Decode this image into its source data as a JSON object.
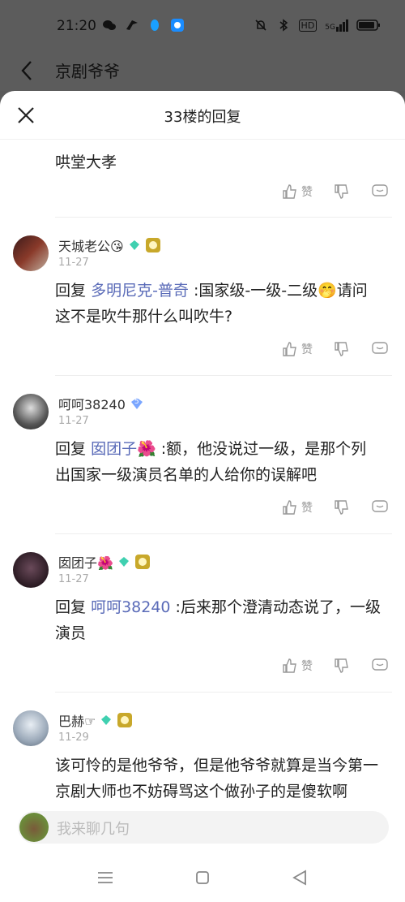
{
  "status": {
    "time": "21:20",
    "left_icons": [
      "wechat-icon",
      "bird-icon",
      "qq-icon",
      "app-icon"
    ],
    "right_icons": [
      "mute-bell-icon",
      "bluetooth-icon",
      "hd-icon",
      "signal-5g-icon",
      "battery-icon"
    ],
    "hd_label": "HD",
    "net_label": "5G"
  },
  "background_page": {
    "title": "京剧爷爷"
  },
  "sheet": {
    "title": "33楼的回复"
  },
  "first_item": {
    "content": "哄堂大孝"
  },
  "actions": {
    "like_label": "赞"
  },
  "replies": [
    {
      "name": "天城老公😘",
      "date": "11-27",
      "prefix": "回复",
      "mention": "多明尼克-普奇",
      "text": " :国家级-一级-二级🤭请问这不是吹牛那什么叫吹牛?"
    },
    {
      "name": "呵呵38240",
      "date": "11-27",
      "prefix": "回复",
      "mention": "囡团子🌺",
      "text": " :额，他没说过一级，是那个列出国家一级演员名单的人给你的误解吧"
    },
    {
      "name": "囡团子🌺",
      "date": "11-27",
      "prefix": "回复",
      "mention": "呵呵38240",
      "text": " :后来那个澄清动态说了，一级演员"
    },
    {
      "name": "巴赫☞",
      "date": "11-29",
      "prefix": "",
      "mention": "",
      "text": "该可怜的是他爷爷，但是他爷爷就算是当今第一京剧大师也不妨碍骂这个做孙子的是傻软啊"
    }
  ],
  "badges": {
    "gem_level_2": "5"
  },
  "input": {
    "placeholder": "我来聊几句"
  },
  "colors": {
    "accent_mention": "#5a6bb8",
    "gem": "#3fd0b0",
    "gem_blue": "#7aa6ff",
    "level_badge": "#c8a82a"
  }
}
